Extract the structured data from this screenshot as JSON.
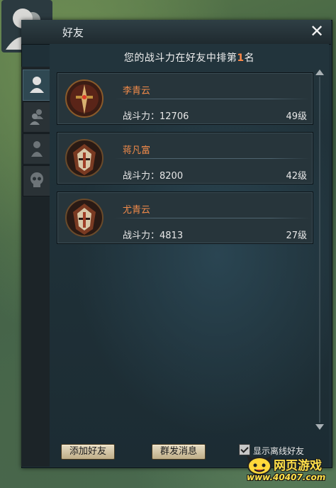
{
  "window": {
    "title": "好友",
    "close_icon": "close-icon"
  },
  "rank": {
    "prefix": "您的战斗力在好友中排第",
    "position": "1",
    "suffix": "名"
  },
  "tabs": [
    {
      "name": "friends",
      "icon": "person-icon",
      "active": true
    },
    {
      "name": "group",
      "icon": "group-icon",
      "active": false
    },
    {
      "name": "blocked",
      "icon": "person-dark-icon",
      "active": false
    },
    {
      "name": "enemies",
      "icon": "skull-icon",
      "active": false
    }
  ],
  "friends": [
    {
      "name": "李青云",
      "power_label": "战斗力：",
      "power": "12706",
      "level": "49级",
      "emblem": "sword-emblem"
    },
    {
      "name": "蒋凡富",
      "power_label": "战斗力：",
      "power": "8200",
      "level": "42级",
      "emblem": "helmet-emblem"
    },
    {
      "name": "尤青云",
      "power_label": "战斗力：",
      "power": "4813",
      "level": "27级",
      "emblem": "helmet-emblem"
    }
  ],
  "buttons": {
    "add_friend": "添加好友",
    "group_message": "群发消息"
  },
  "options": {
    "show_offline_label": "显示离线好友",
    "show_offline_checked": true
  },
  "watermark": {
    "line1": "网页游戏",
    "line2": "www.40407.com"
  },
  "colors": {
    "name_color": "#f08a4a",
    "highlight": "#ff8a4a"
  }
}
